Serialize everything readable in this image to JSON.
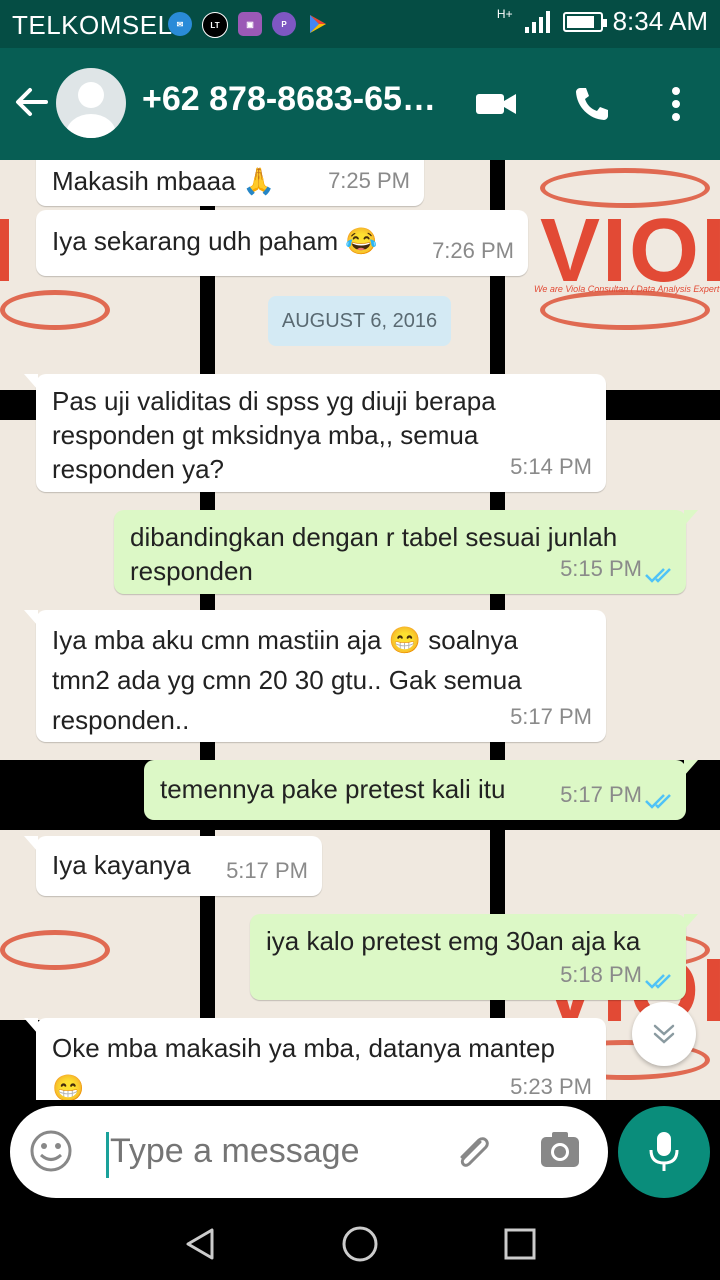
{
  "status_bar": {
    "carrier": "TELKOMSEL",
    "network": "H+",
    "time": "8:34 AM",
    "battery_level": 0.85,
    "notification_icons": [
      "message-icon",
      "line-today-icon",
      "gallery-icon",
      "p-app-icon",
      "play-store-icon"
    ]
  },
  "header": {
    "contact_name": "+62 878-8683-65…"
  },
  "wallpaper": {
    "logo_text": "VIOLA",
    "tagline": "We are Viola Consultan ( Data Analysis Expert )"
  },
  "messages": [
    {
      "dir": "in",
      "text": "Makasih mbaaa 🙏",
      "time": "7:25 PM"
    },
    {
      "dir": "in",
      "text": "Iya sekarang udh paham 😂",
      "time": "7:26 PM"
    },
    {
      "dir": "date",
      "text": "AUGUST 6, 2016"
    },
    {
      "dir": "in",
      "text": "Pas uji validitas di spss yg diuji berapa responden gt mksidnya mba,, semua responden ya?",
      "time": "5:14 PM"
    },
    {
      "dir": "out",
      "text": "dibandingkan dengan r tabel sesuai junlah responden",
      "time": "5:15 PM",
      "status": "read"
    },
    {
      "dir": "in",
      "text": "Iya mba aku cmn mastiin aja 😁 soalnya tmn2 ada yg cmn 20 30 gtu.. Gak semua responden..",
      "time": "5:17 PM"
    },
    {
      "dir": "out",
      "text": "temennya pake pretest kali itu",
      "time": "5:17 PM",
      "status": "read"
    },
    {
      "dir": "in",
      "text": "Iya kayanya",
      "time": "5:17 PM"
    },
    {
      "dir": "out",
      "text": "iya kalo pretest emg 30an aja ka",
      "time": "5:18 PM",
      "status": "read"
    },
    {
      "dir": "in",
      "text": "Oke mba makasih ya mba, datanya mantep 😁",
      "time": "5:23 PM"
    }
  ],
  "input": {
    "placeholder": "Type a message"
  },
  "colors": {
    "header": "#075e54",
    "status_bar": "#054d44",
    "outgoing_bubble": "#dcf8c6",
    "incoming_bubble": "#ffffff",
    "read_ticks": "#4fc3f7",
    "mic_button": "#0a8d7b"
  }
}
